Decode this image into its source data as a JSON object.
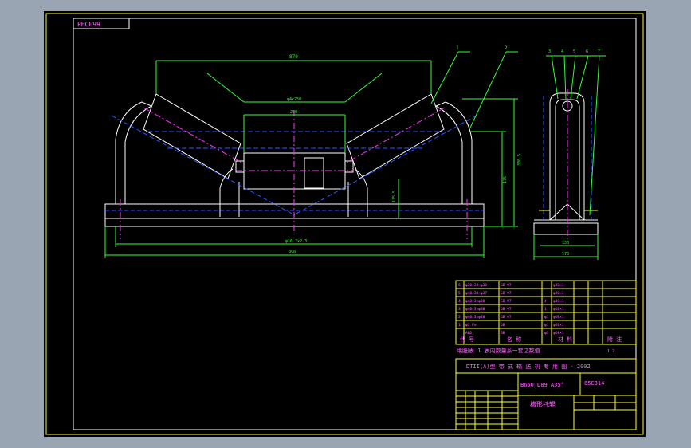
{
  "drawing_code": "PHC099",
  "dimensions": {
    "overall_top": "870",
    "inner_span": "φ4×250",
    "center_roller": "250",
    "height_total": "308.5",
    "height_center": "175",
    "height_left": "135.5",
    "bottom_inner": "φ16.7×2.3",
    "bottom_total": "950",
    "side_width_inner": "130",
    "side_width_total": "170"
  },
  "balloons": [
    "1",
    "2",
    "3",
    "4",
    "5",
    "6",
    "7"
  ],
  "parts_list": {
    "rows": [
      {
        "no": "6",
        "name": "φ20×33×φ30",
        "qty": "GB 97",
        "material": "",
        "note": "φ20×1"
      },
      {
        "no": "5",
        "name": "φ40×33×φ37",
        "qty": "GB 97",
        "material": "",
        "note": "φ20×1"
      },
      {
        "no": "4",
        "name": "φ40×3×φ30",
        "qty": "GB 97",
        "material": "4",
        "note": "φ20×1"
      },
      {
        "no": "3",
        "name": "φ40×3×φ80",
        "qty": "GB 97",
        "material": "1",
        "note": "φ20×1"
      },
      {
        "no": "2",
        "name": "φ40×3×φ30",
        "qty": "GB 97",
        "material": "φ1",
        "note": "φ20×1"
      },
      {
        "no": "1",
        "name": "φ3 Fe",
        "qty": "GB",
        "material": "φ1",
        "note": "φ20×1"
      },
      {
        "no": "",
        "name": "ARD",
        "qty": "GB",
        "material": "φ3",
        "note": "φ20×1"
      }
    ],
    "header": [
      "代 号",
      "名 称",
      "材 料",
      "附 注"
    ],
    "note_line": "明细表  1 表内数量系一套之数值",
    "note_small": "1:2"
  },
  "title_block": {
    "standard": "DTII(A)型  带 式 输 送 机 专 用 图 - 2002",
    "model": "B650 D89 A35°",
    "code": "65C314",
    "name": "槽形托辊"
  }
}
